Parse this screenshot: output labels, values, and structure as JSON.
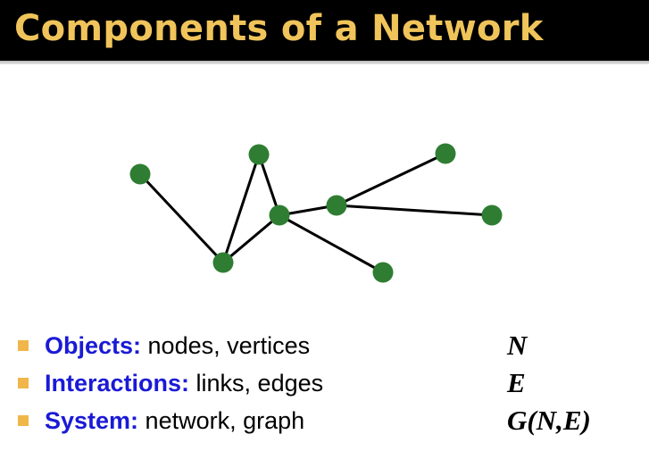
{
  "slide": {
    "title": "Components of a Network"
  },
  "colors": {
    "title_bar": "#000000",
    "title_text": "#f0c45a",
    "node_fill": "#2e7d32",
    "edge": "#000000",
    "bullet_marker": "#f0b64a",
    "term_text": "#1a1ad6"
  },
  "bullets": [
    {
      "term": "Objects:",
      "description": " nodes, vertices",
      "symbol": "N"
    },
    {
      "term": "Interactions:",
      "description": " links, edges",
      "symbol": "E"
    },
    {
      "term": "System:",
      "description": " network, graph",
      "symbol": "G(N,E)"
    }
  ]
}
